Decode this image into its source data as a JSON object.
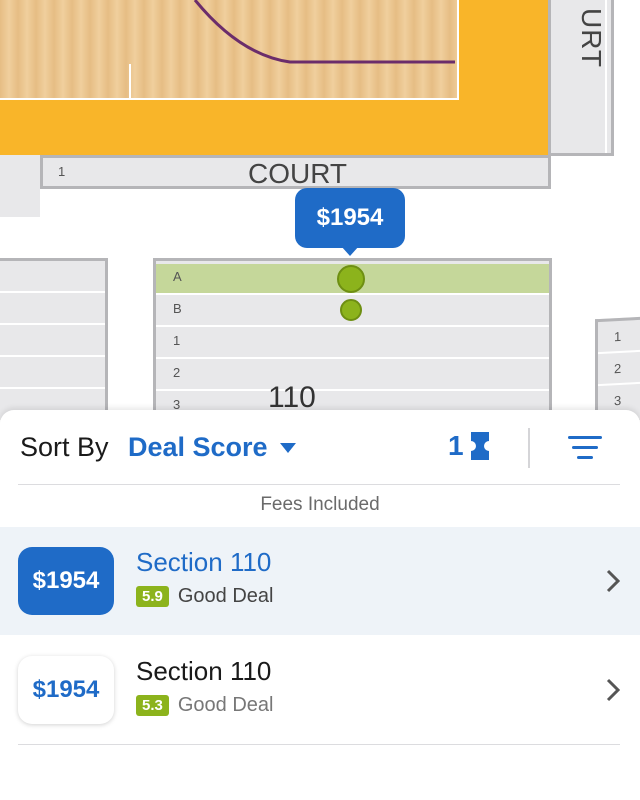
{
  "map": {
    "court_label": "COURT",
    "court_label_side": "URT",
    "court_row_label": "1",
    "section_label": "110",
    "rows": [
      "A",
      "B",
      "1",
      "2",
      "3"
    ],
    "right_rows": [
      "1",
      "2",
      "3"
    ],
    "price_bubble": "$1954",
    "colors": {
      "court_orange": "#f9b529",
      "wood": "#e9c48f",
      "court_line": "#6b2d6b",
      "selected_row": "#c5d79a",
      "seat_dot": "#8cb31c",
      "bubble": "#1f6bc7"
    }
  },
  "panel": {
    "sort_by_label": "Sort By",
    "sort_value": "Deal Score",
    "ticket_count": "1",
    "fees_note": "Fees Included"
  },
  "listings": [
    {
      "price": "$1954",
      "section": "Section 110",
      "score": "5.9",
      "deal_label": "Good Deal",
      "selected": true
    },
    {
      "price": "$1954",
      "section": "Section 110",
      "score": "5.3",
      "deal_label": "Good Deal",
      "selected": false
    }
  ],
  "icons": {
    "sort_dropdown": "caret-down-icon",
    "ticket": "ticket-icon",
    "filter": "filter-lines-icon",
    "chevron": "chevron-right-icon"
  },
  "accent": "#1f6bc7"
}
